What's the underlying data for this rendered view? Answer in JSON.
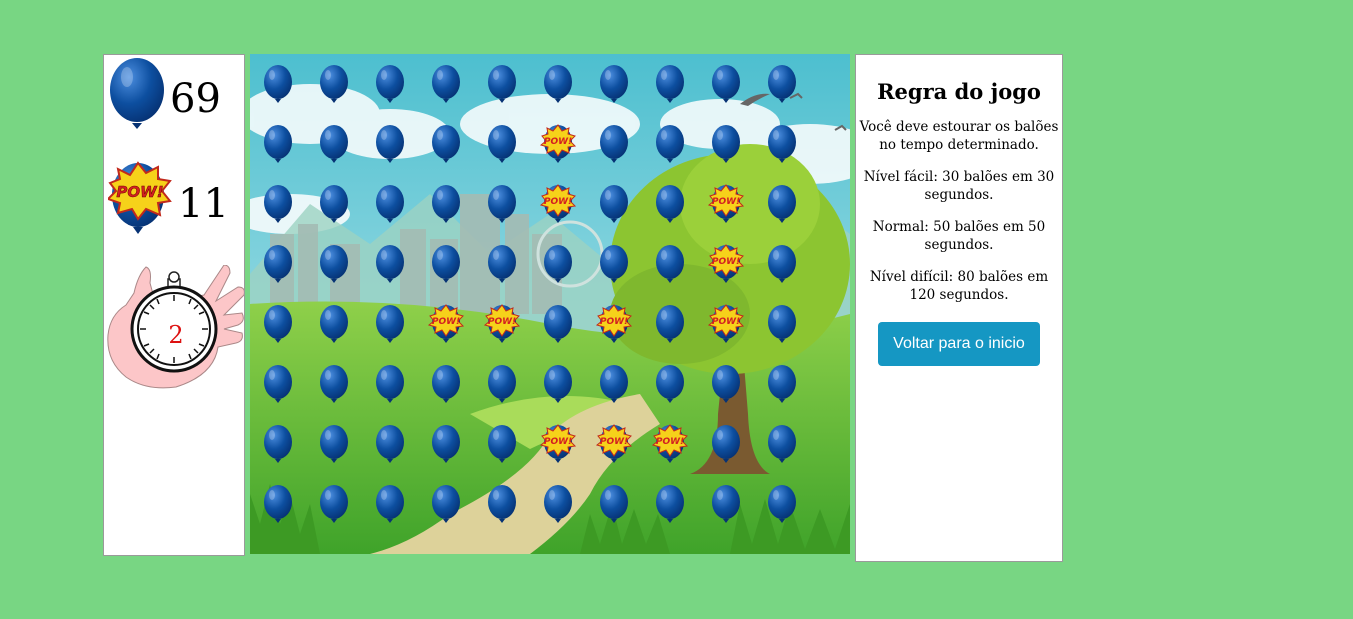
{
  "stats": {
    "balloons_remaining": "69",
    "balloons_popped": "11",
    "timer": "2",
    "pow_text": "POW!"
  },
  "rules": {
    "title": "Regra do jogo",
    "intro": "Você deve estourar os balões no tempo determinado.",
    "easy": "Nível fácil: 30 balões em 30 segundos.",
    "normal": "Normal: 50 balões em 50 segundos.",
    "hard": "Nível difícil: 80 balões em 120 segundos.",
    "back_button": "Voltar para o inicio"
  },
  "board": {
    "columns": 10,
    "rows": 8,
    "popped": [
      [
        1,
        5
      ],
      [
        2,
        5
      ],
      [
        2,
        8
      ],
      [
        3,
        8
      ],
      [
        4,
        3
      ],
      [
        4,
        4
      ],
      [
        4,
        6
      ],
      [
        4,
        8
      ],
      [
        6,
        5
      ],
      [
        6,
        6
      ],
      [
        6,
        7
      ]
    ]
  },
  "colors": {
    "background": "#78d683",
    "balloon": "#0d4fa0",
    "button": "#1597c3",
    "timer_digit": "#dd1111"
  }
}
